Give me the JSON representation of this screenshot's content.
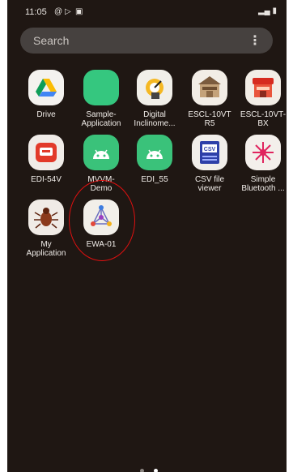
{
  "status_bar": {
    "time": "11:05",
    "icons": [
      "at-icon",
      "play-icon",
      "square-icon"
    ],
    "signal": "▂▄ ▮"
  },
  "search": {
    "placeholder": "Search",
    "menu": "⋮"
  },
  "apps": [
    {
      "label": "Drive",
      "icon": "google-drive-icon"
    },
    {
      "label": "Sample-\nApplication",
      "icon": "green-app-icon"
    },
    {
      "label": "Digital\nInclinome...",
      "icon": "digital-inclinometer-icon"
    },
    {
      "label": "ESCL-10VT\nR5",
      "icon": "escl-shop-icon"
    },
    {
      "label": "ESCL-10VT-\nBX",
      "icon": "escl-shop-red-icon"
    },
    {
      "label": "EDI-54V",
      "icon": "edi-red-icon"
    },
    {
      "label": "MVVM-\nDemo",
      "icon": "android-icon"
    },
    {
      "label": "EDI_55",
      "icon": "android-icon"
    },
    {
      "label": "CSV file\nviewer",
      "icon": "csv-viewer-icon"
    },
    {
      "label": "Simple\nBluetooth ...",
      "icon": "bluetooth-star-icon"
    },
    {
      "label": "My\nApplication",
      "icon": "bug-icon"
    },
    {
      "label": "EWA-01",
      "icon": "ewa-network-icon"
    }
  ],
  "annotation": {
    "color": "#e01010"
  },
  "pager": {
    "pages": 2,
    "current": 2
  }
}
